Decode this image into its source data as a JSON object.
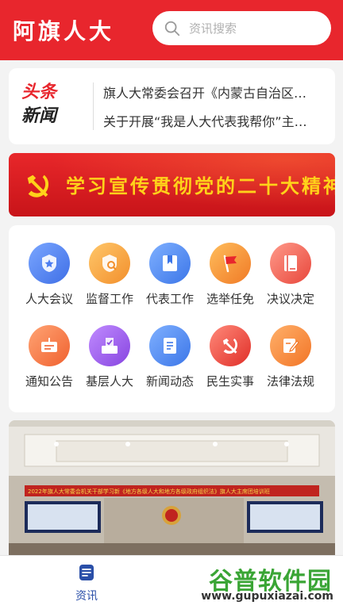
{
  "header": {
    "title": "阿旗人大",
    "search_placeholder": "资讯搜索",
    "bg_color": "#e8262d"
  },
  "headlines": {
    "logo_top": "头条",
    "logo_bottom": "新闻",
    "items": [
      "旗人大常委会召开《内蒙古自治区…",
      "关于开展“我是人大代表我帮你”主…"
    ]
  },
  "banner": {
    "text": "学习宣传贯彻党的二十大精神",
    "emblem": "party-emblem-icon"
  },
  "grid": [
    {
      "label": "人大会议",
      "icon": "meeting-icon",
      "color": "#4d7ef0"
    },
    {
      "label": "监督工作",
      "icon": "supervision-icon",
      "color": "#f5a43a"
    },
    {
      "label": "代表工作",
      "icon": "bookmark-icon",
      "color": "#4a86ef"
    },
    {
      "label": "选举任免",
      "icon": "flag-icon",
      "color": "#f38a2e"
    },
    {
      "label": "决议决定",
      "icon": "book-icon",
      "color": "#ee5d4f"
    },
    {
      "label": "通知公告",
      "icon": "notice-board-icon",
      "color": "#f2733a"
    },
    {
      "label": "基层人大",
      "icon": "ballot-icon",
      "color": "#9b5ce8"
    },
    {
      "label": "新闻动态",
      "icon": "document-icon",
      "color": "#4a86ef"
    },
    {
      "label": "民生实事",
      "icon": "party-emblem-icon",
      "color": "#e63a34"
    },
    {
      "label": "法律法规",
      "icon": "edit-icon",
      "color": "#f58a34"
    }
  ],
  "photo": {
    "screen_caption": "2022年旗人大常委会机关干部学习新《地方各级人大和地方各级政府组织法》旗人大主席团培训班"
  },
  "tabbar": {
    "items": [
      {
        "label": "资讯",
        "icon": "news-tab-icon",
        "active": true
      }
    ]
  },
  "watermark": {
    "brand": "谷普软件园",
    "url": "www.gupuxiazai.com"
  }
}
